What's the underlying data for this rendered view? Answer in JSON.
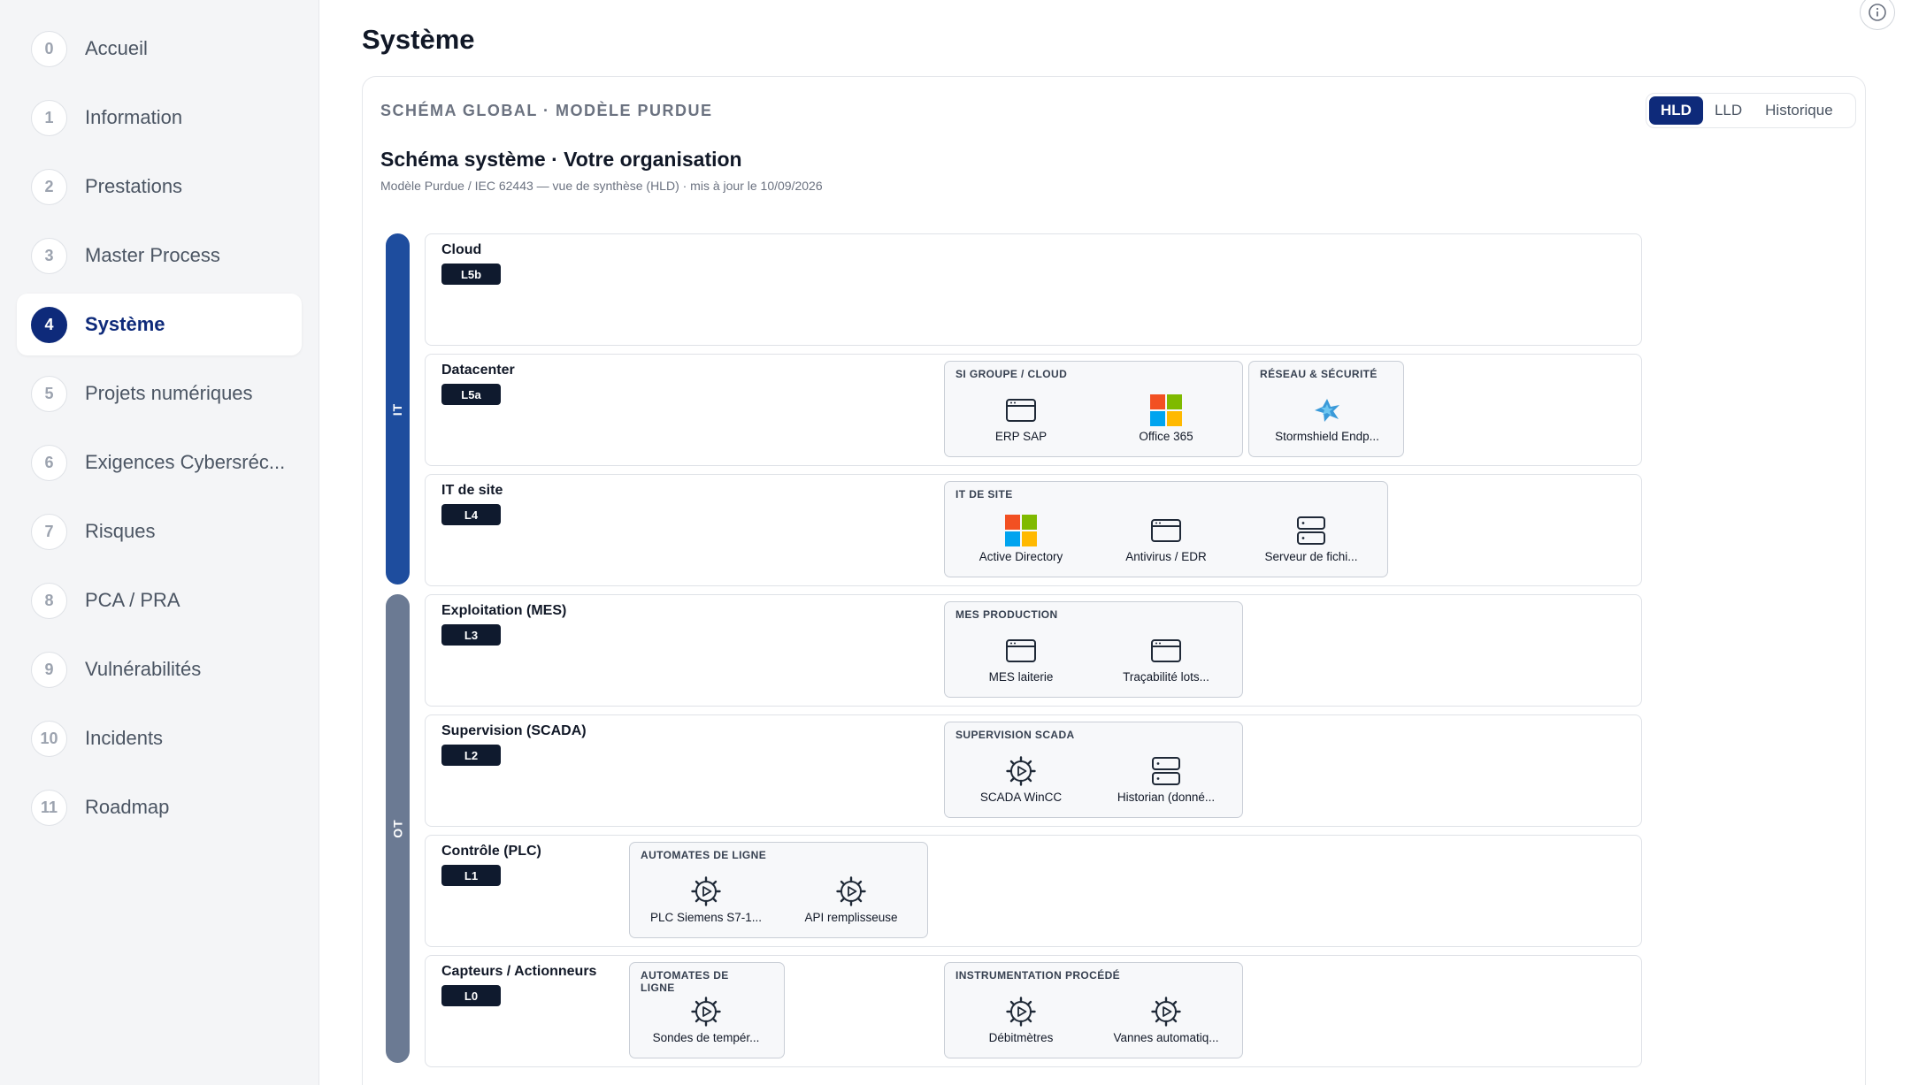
{
  "sidebar": {
    "items": [
      {
        "num": "0",
        "label": "Accueil"
      },
      {
        "num": "1",
        "label": "Information"
      },
      {
        "num": "2",
        "label": "Prestations"
      },
      {
        "num": "3",
        "label": "Master Process"
      },
      {
        "num": "4",
        "label": "Système",
        "active": true
      },
      {
        "num": "5",
        "label": "Projets numériques"
      },
      {
        "num": "6",
        "label": "Exigences Cybersécurité"
      },
      {
        "num": "7",
        "label": "Risques"
      },
      {
        "num": "8",
        "label": "PCA / PRA"
      },
      {
        "num": "9",
        "label": "Vulnérabilités"
      },
      {
        "num": "10",
        "label": "Incidents"
      },
      {
        "num": "11",
        "label": "Roadmap"
      }
    ],
    "item_labels_display": {
      "6": "Exigences Cybersréc..."
    }
  },
  "page": {
    "title": "Système"
  },
  "card": {
    "kicker": "SCHÉMA GLOBAL · MODÈLE PURDUE",
    "title": "Schéma système · Votre organisation",
    "subtitle": "Modèle Purdue / IEC 62443 — vue de synthèse (HLD) · mis à jour le 10/09/2026",
    "view_tabs": [
      {
        "label": "HLD",
        "active": true
      },
      {
        "label": "LLD",
        "active": false
      },
      {
        "label": "Historique",
        "active": false
      }
    ]
  },
  "zones": {
    "it": "IT",
    "ot": "OT"
  },
  "levels": [
    {
      "name": "Cloud",
      "badge": "L5b",
      "groups": []
    },
    {
      "name": "Datacenter",
      "badge": "L5a",
      "groups": [
        {
          "title": "SI GROUPE / CLOUD",
          "assets": [
            {
              "label": "ERP SAP",
              "icon": "window-icon"
            },
            {
              "label": "Office 365",
              "icon": "microsoft-logo-icon"
            }
          ]
        },
        {
          "title": "RÉSEAU & SÉCURITÉ",
          "assets": [
            {
              "label": "Stormshield Endp...",
              "icon": "stormshield-logo-icon"
            }
          ]
        }
      ]
    },
    {
      "name": "IT de site",
      "badge": "L4",
      "groups": [
        {
          "title": "IT DE SITE",
          "assets": [
            {
              "label": "Active Directory",
              "icon": "microsoft-logo-icon"
            },
            {
              "label": "Antivirus / EDR",
              "icon": "window-icon"
            },
            {
              "label": "Serveur de fichi...",
              "icon": "server-icon"
            }
          ]
        }
      ]
    },
    {
      "name": "Exploitation (MES)",
      "badge": "L3",
      "groups": [
        {
          "title": "MES PRODUCTION",
          "assets": [
            {
              "label": "MES laiterie",
              "icon": "window-icon"
            },
            {
              "label": "Traçabilité lots...",
              "icon": "window-icon"
            }
          ]
        }
      ]
    },
    {
      "name": "Supervision (SCADA)",
      "badge": "L2",
      "groups": [
        {
          "title": "SUPERVISION SCADA",
          "assets": [
            {
              "label": "SCADA WinCC",
              "icon": "gear-play-icon"
            },
            {
              "label": "Historian (donné...",
              "icon": "server-icon"
            }
          ]
        }
      ]
    },
    {
      "name": "Contrôle (PLC)",
      "badge": "L1",
      "groups": [
        {
          "title": "AUTOMATES DE LIGNE",
          "assets": [
            {
              "label": "PLC Siemens S7-1...",
              "icon": "gear-play-icon"
            },
            {
              "label": "API remplisseuse",
              "icon": "gear-play-icon"
            }
          ]
        }
      ]
    },
    {
      "name": "Capteurs / Actionneurs",
      "badge": "L0",
      "groups": [
        {
          "title": "AUTOMATES DE LIGNE",
          "assets": [
            {
              "label": "Sondes de tempér...",
              "icon": "gear-play-icon"
            }
          ]
        },
        {
          "title": "INSTRUMENTATION PROCÉDÉ",
          "assets": [
            {
              "label": "Débitmètres",
              "icon": "gear-play-icon"
            },
            {
              "label": "Vannes automatiq...",
              "icon": "gear-play-icon"
            }
          ]
        }
      ]
    }
  ],
  "colors": {
    "accent": "#0e2a7a",
    "it_zone": "#1e4d9e",
    "ot_zone": "#6b7a93",
    "badge": "#0f1a2e"
  }
}
